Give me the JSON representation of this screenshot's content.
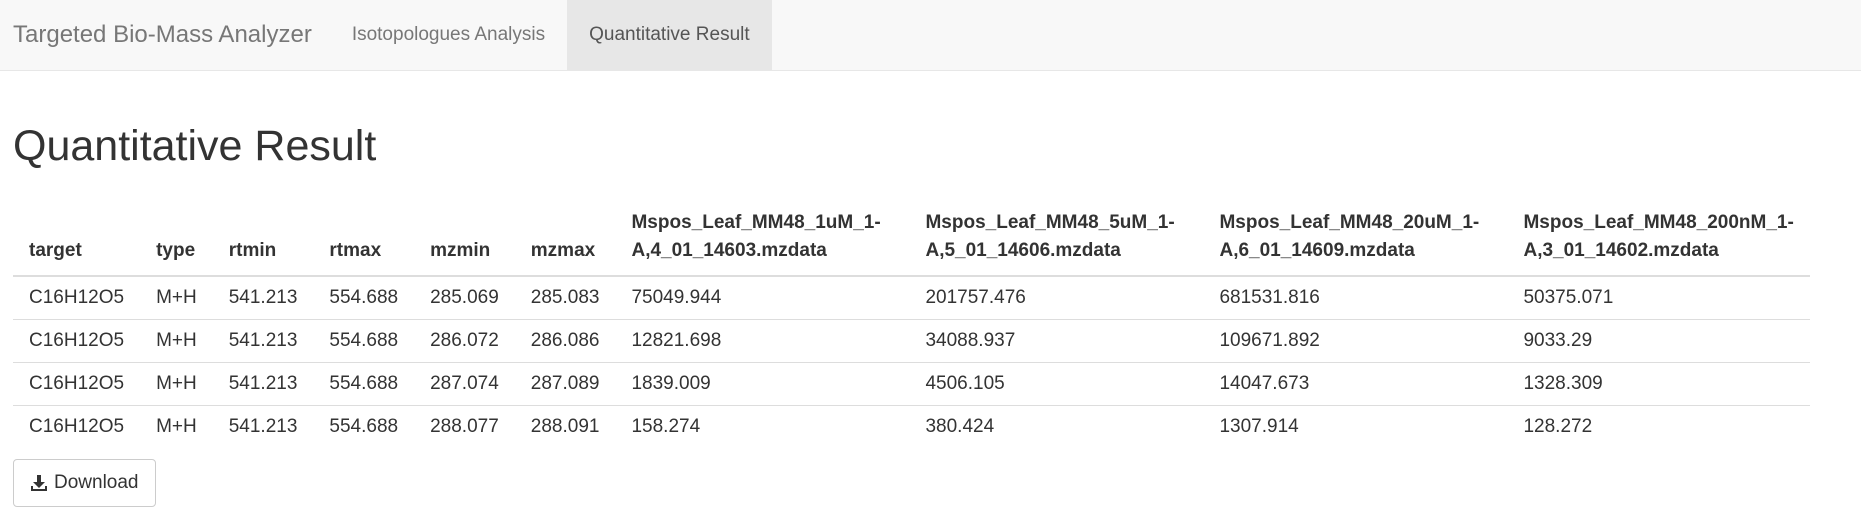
{
  "navbar": {
    "brand": "Targeted Bio-Mass Analyzer",
    "tabs": [
      {
        "label": "Isotopologues Analysis",
        "active": false
      },
      {
        "label": "Quantitative Result",
        "active": true
      }
    ]
  },
  "page": {
    "title": "Quantitative Result"
  },
  "table": {
    "headers": [
      "target",
      "type",
      "rtmin",
      "rtmax",
      "mzmin",
      "mzmax",
      "Mspos_Leaf_MM48_1uM_1-A,4_01_14603.mzdata",
      "Mspos_Leaf_MM48_5uM_1-A,5_01_14606.mzdata",
      "Mspos_Leaf_MM48_20uM_1-A,6_01_14609.mzdata",
      "Mspos_Leaf_MM48_200nM_1-A,3_01_14602.mzdata"
    ],
    "rows": [
      [
        "C16H12O5",
        "M+H",
        "541.213",
        "554.688",
        "285.069",
        "285.083",
        "75049.944",
        "201757.476",
        "681531.816",
        "50375.071"
      ],
      [
        "C16H12O5",
        "M+H",
        "541.213",
        "554.688",
        "286.072",
        "286.086",
        "12821.698",
        "34088.937",
        "109671.892",
        "9033.29"
      ],
      [
        "C16H12O5",
        "M+H",
        "541.213",
        "554.688",
        "287.074",
        "287.089",
        "1839.009",
        "4506.105",
        "14047.673",
        "1328.309"
      ],
      [
        "C16H12O5",
        "M+H",
        "541.213",
        "554.688",
        "288.077",
        "288.091",
        "158.274",
        "380.424",
        "1307.914",
        "128.272"
      ]
    ]
  },
  "download": {
    "label": "Download",
    "icon": "download-icon"
  }
}
